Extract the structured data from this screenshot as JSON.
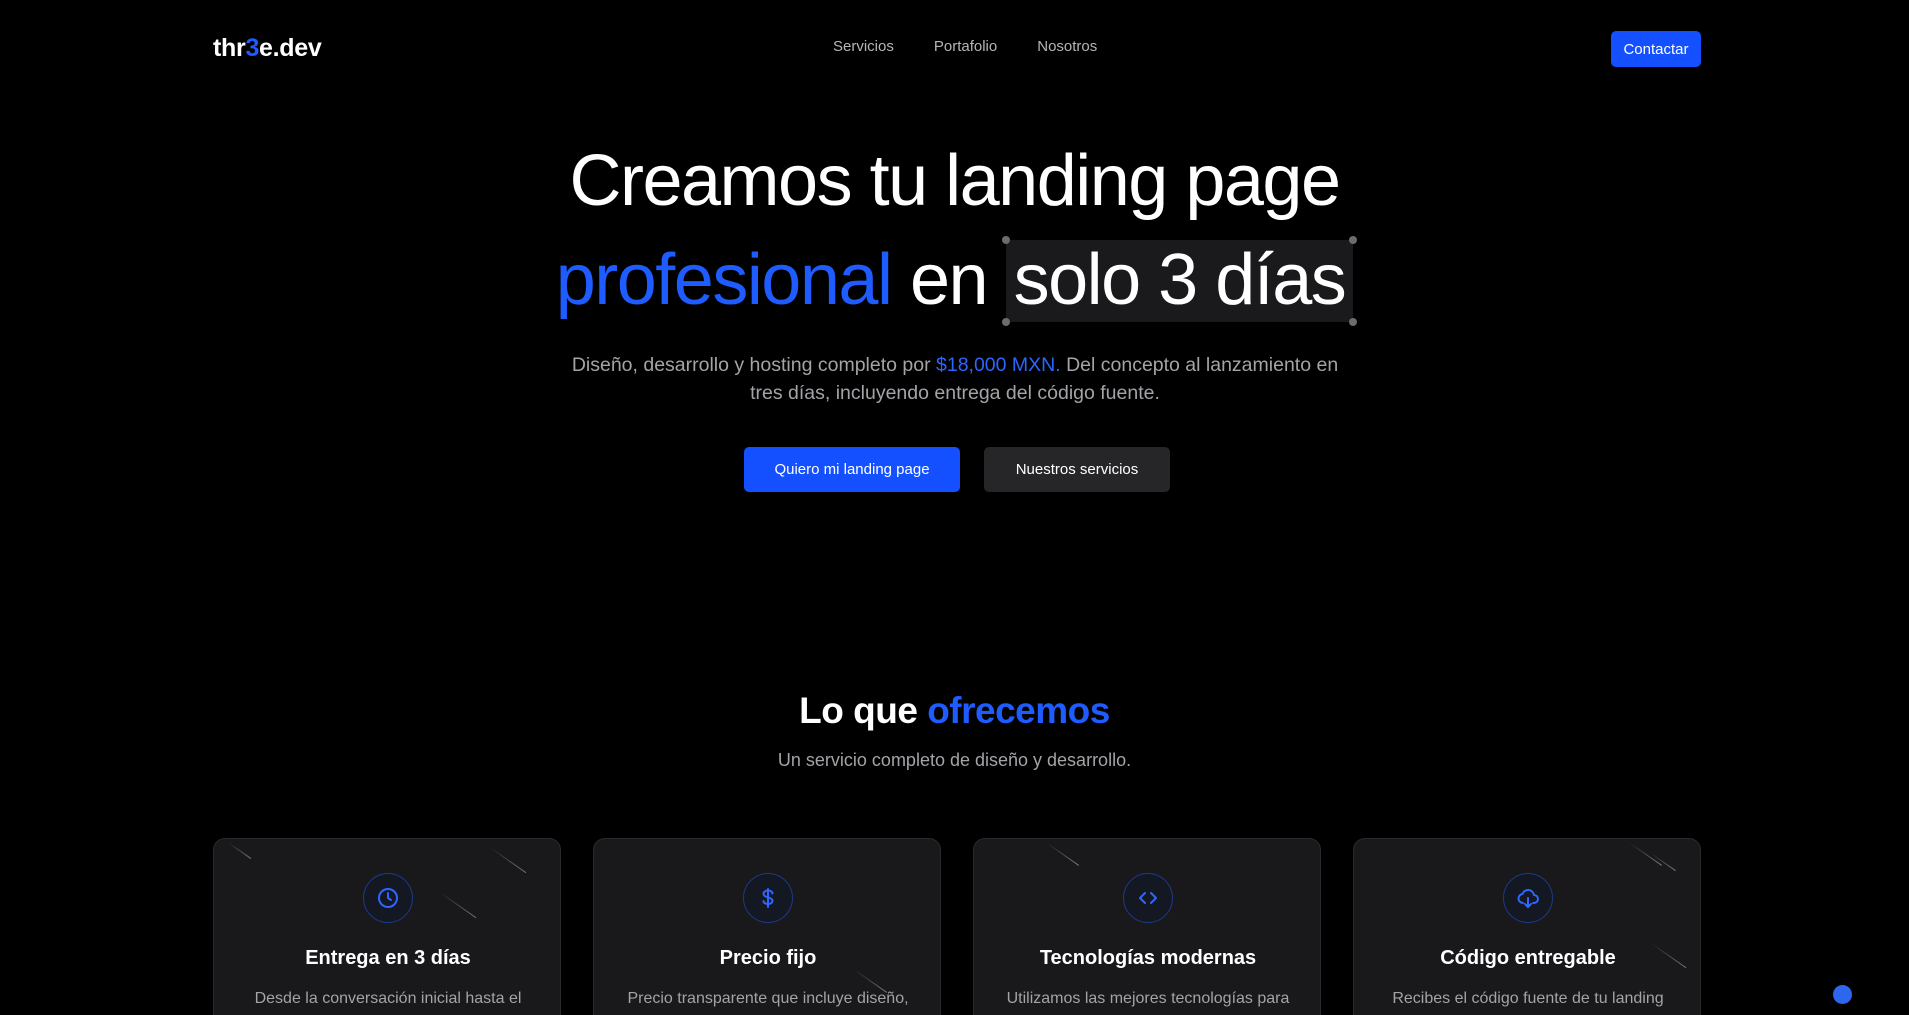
{
  "nav": {
    "logo_part1": "thr",
    "logo_accent": "3",
    "logo_part2": "e.dev",
    "links": [
      "Servicios",
      "Portafolio",
      "Nosotros"
    ],
    "contact_label": "Contactar"
  },
  "hero": {
    "line1": "Creamos tu landing page",
    "line2_blue": "profesional",
    "line2_mid": "en",
    "line2_highlight": "solo 3 días",
    "sub_part1": "Diseño, desarrollo y hosting completo por ",
    "sub_price": "$18,000 MXN.",
    "sub_part2": " Del concepto al lanzamiento en tres días, incluyendo entrega del código fuente.",
    "cta_primary": "Quiero mi landing page",
    "cta_secondary": "Nuestros servicios"
  },
  "services": {
    "title_plain": "Lo que ",
    "title_blue": "ofrecemos",
    "subtitle": "Un servicio completo de diseño y desarrollo.",
    "cards": [
      {
        "icon": "clock-icon",
        "title": "Entrega en 3 días",
        "desc": "Desde la conversación inicial hasta el"
      },
      {
        "icon": "dollar-icon",
        "title": "Precio fijo",
        "desc": "Precio transparente que incluye diseño,"
      },
      {
        "icon": "code-icon",
        "title": "Tecnologías modernas",
        "desc": "Utilizamos las mejores tecnologías para"
      },
      {
        "icon": "cloud-download-icon",
        "title": "Código entregable",
        "desc": "Recibes el código fuente de tu landing"
      }
    ]
  },
  "colors": {
    "accent": "#1450ff",
    "accent_text": "#1f5cff",
    "background": "#000000",
    "card_bg": "#19191b"
  }
}
